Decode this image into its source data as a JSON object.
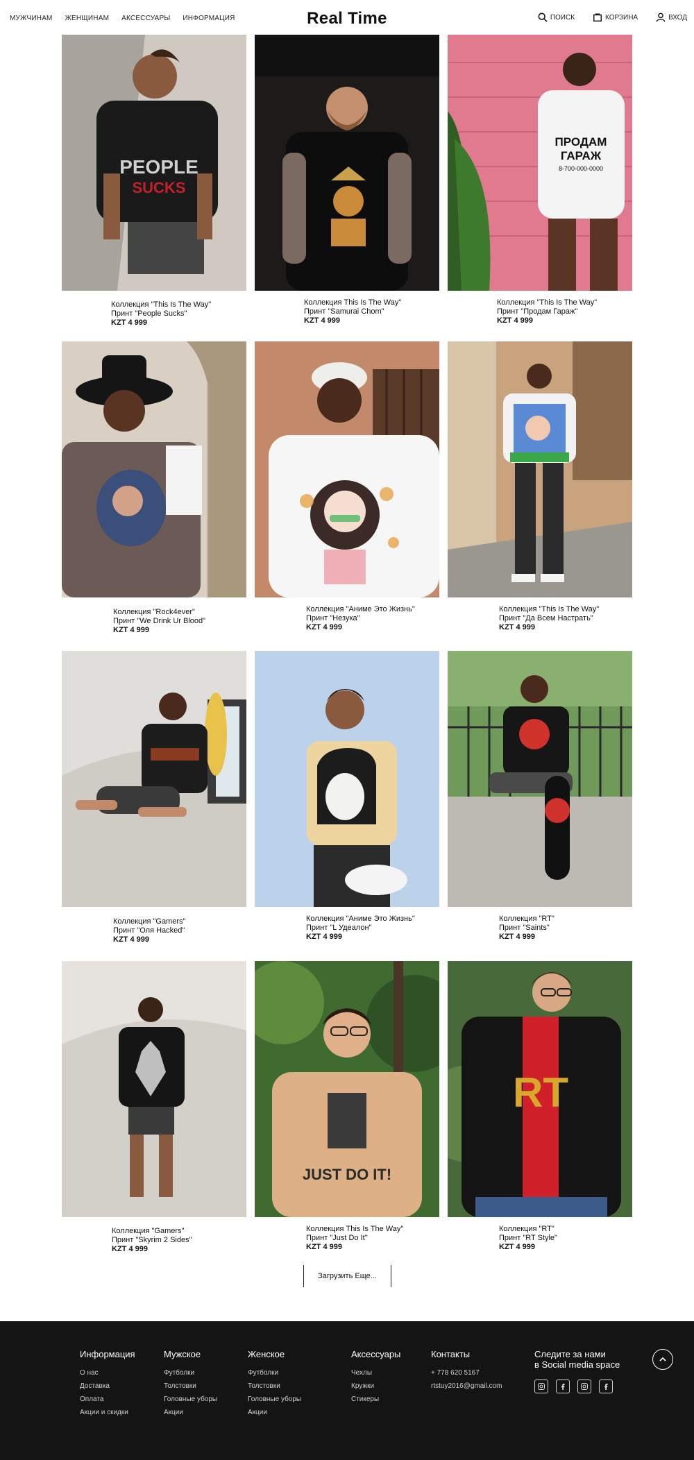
{
  "header": {
    "logo": "Real Time",
    "nav_left": [
      "МУЖЧИНАМ",
      "ЖЕНЩИНАМ",
      "АКСЕССУАРЫ",
      "ИНФОРМАЦИЯ"
    ],
    "search": "ПОИСК",
    "cart": "КОРЗИНА",
    "login": "ВХОД"
  },
  "products": [
    {
      "collection": "Коллекция \"This Is The Way\"",
      "print": "Принт \"People Sucks\"",
      "price": "KZT 4 999"
    },
    {
      "collection": "Коллекция This Is The Way\"",
      "print": "Принт \"Samurai Chom\"",
      "price": "KZT 4 999"
    },
    {
      "collection": "Коллекция \"This Is The Way\"",
      "print": "Принт \"Продам Гараж\"",
      "price": "KZT 4 999"
    },
    {
      "collection": "Коллекция \"Rock4ever\"",
      "print": "Принт \"We Drink Ur Blood\"",
      "price": "KZT 4 999"
    },
    {
      "collection": "Коллекция \"Аниме Это Жизнь\"",
      "print": "Принт \"Незука\"",
      "price": "KZT 4 999"
    },
    {
      "collection": "Коллекция \"This Is The Way\"",
      "print": "Принт \"Да Всем Настрать\"",
      "price": "KZT 4 999"
    },
    {
      "collection": "Коллекция \"Gamers\"",
      "print": "Принт \"Оля Hacked\"",
      "price": "KZT 4 999"
    },
    {
      "collection": "Коллекция \"Аниме Это Жизнь\"",
      "print": "Принт \"L Удеалон\"",
      "price": "KZT 4 999"
    },
    {
      "collection": "Коллекция \"RT\"",
      "print": "Принт \"Saints\"",
      "price": "KZT 4 999"
    },
    {
      "collection": "Коллекция \"Gamers\"",
      "print": "Принт \"Skyrim 2 Sides\"",
      "price": "KZT 4 999"
    },
    {
      "collection": "Коллекция This Is The Way\"",
      "print": "Принт \"Just Do It\"",
      "price": "KZT 4 999"
    },
    {
      "collection": "Коллекция \"RT\"",
      "print": "Принт \"RT Style\"",
      "price": "KZT 4 999"
    }
  ],
  "load_more": "Загрузить Еще...",
  "footer": {
    "info": {
      "title": "Информация",
      "links": [
        "О нас",
        "Доставка",
        "Оплата",
        "Акции и скидки"
      ]
    },
    "men": {
      "title": "Мужское",
      "links": [
        "Футболки",
        "Толстовки",
        "Головные уборы",
        "Акции"
      ]
    },
    "women": {
      "title": "Женское",
      "links": [
        "Футболки",
        "Толстовки",
        "Головные уборы",
        "Акции"
      ]
    },
    "accessories": {
      "title": "Аксессуары",
      "links": [
        "Чехлы",
        "Кружки",
        "Стикеры"
      ]
    },
    "contacts": {
      "title": "Контакты",
      "phone": "+ 778 620 5167",
      "email": "rtstuy2016@gmail.com"
    },
    "social": {
      "title_line1": "Следите за нами",
      "title_line2": "в Social media space",
      "icons": [
        "instagram-icon",
        "facebook-icon",
        "instagram-icon",
        "facebook-icon"
      ]
    }
  }
}
